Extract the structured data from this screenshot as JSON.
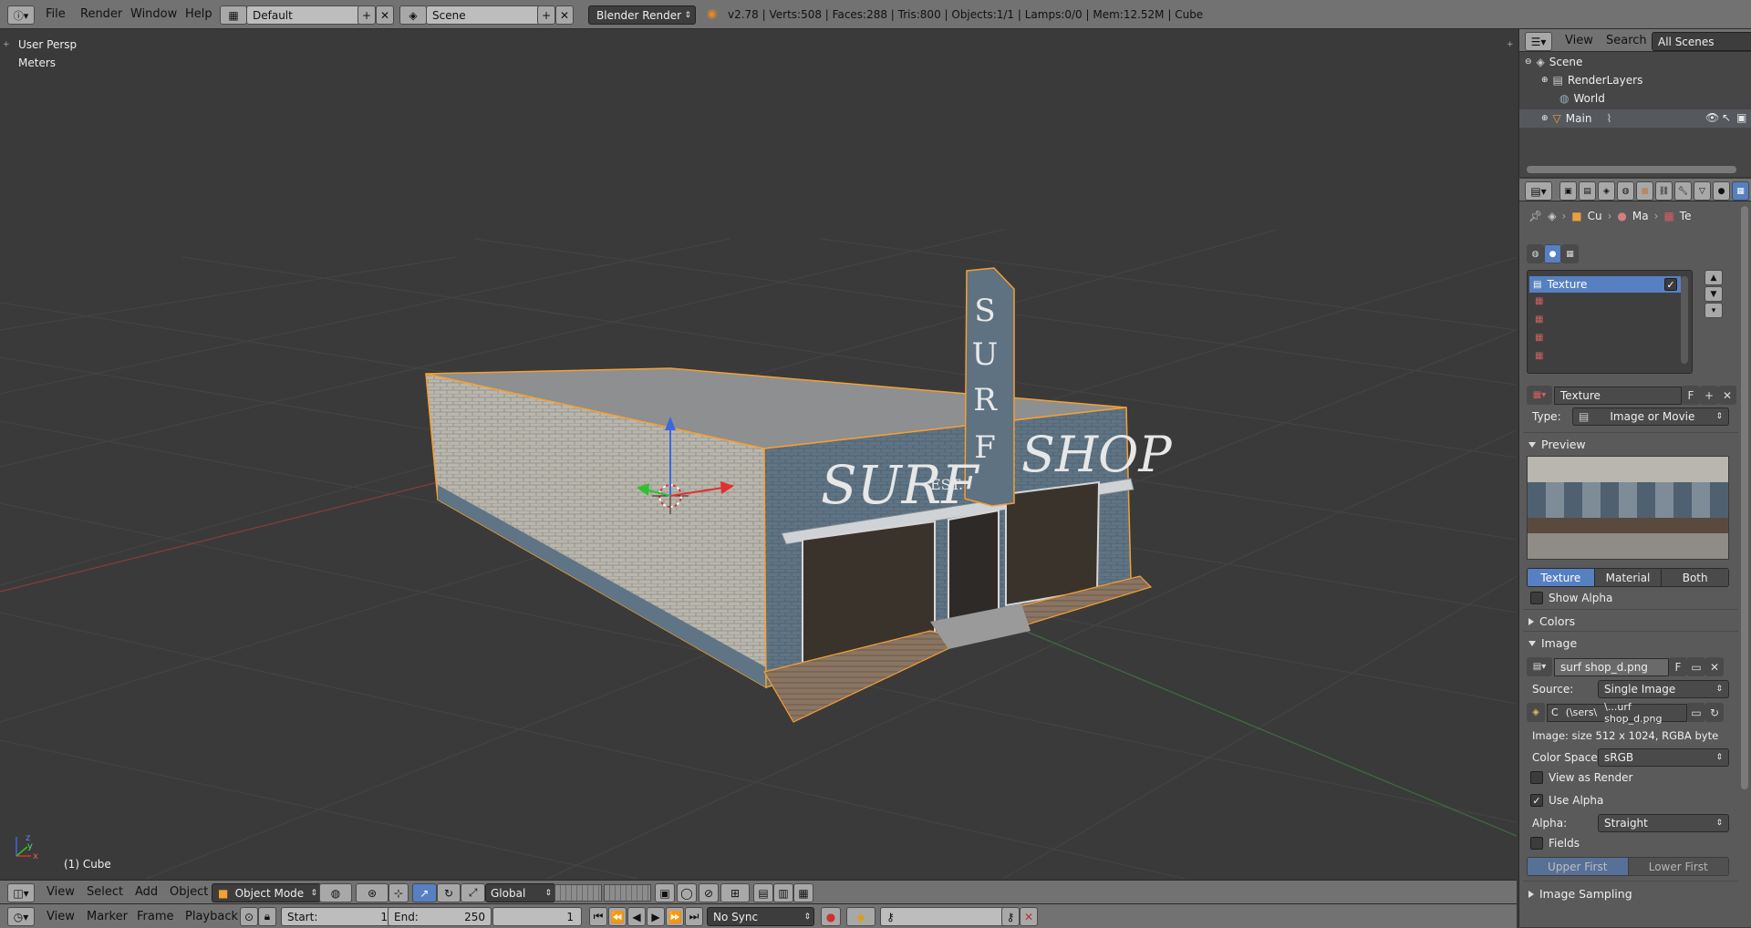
{
  "topbar": {
    "menus": [
      "File",
      "Render",
      "Window",
      "Help"
    ],
    "layout": "Default",
    "scene": "Scene",
    "engine": "Blender Render",
    "stats": "v2.78 | Verts:508 | Faces:288 | Tris:800 | Objects:1/1 | Lamps:0/0 | Mem:12.52M | Cube"
  },
  "viewport": {
    "view_name": "User Persp",
    "units": "Meters",
    "object_label": "(1) Cube",
    "sign_top": "SURF",
    "sign_left": "SURF",
    "sign_right": "SHOP",
    "sign_est": "EST."
  },
  "view3d_header": {
    "menus": [
      "View",
      "Select",
      "Add",
      "Object"
    ],
    "mode": "Object Mode",
    "orientation": "Global"
  },
  "timeline": {
    "menus": [
      "View",
      "Marker",
      "Frame",
      "Playback"
    ],
    "start_label": "Start:",
    "start_value": "1",
    "end_label": "End:",
    "end_value": "250",
    "current_frame": "1",
    "sync": "No Sync"
  },
  "outliner": {
    "menus": [
      "View",
      "Search"
    ],
    "filter": "All Scenes",
    "items": [
      "Scene",
      "RenderLayers",
      "World",
      "Main"
    ]
  },
  "properties": {
    "breadcrumb": [
      "Cu",
      "Ma",
      "Te"
    ],
    "texture_slot": "Texture",
    "texture_name": "Texture",
    "fake_user": "F",
    "type_label": "Type:",
    "type_value": "Image or Movie",
    "preview_header": "Preview",
    "preview_tabs": [
      "Texture",
      "Material",
      "Both"
    ],
    "show_alpha": "Show Alpha",
    "colors_header": "Colors",
    "image_header": "Image",
    "image_name": "surf shop_d.png",
    "source_label": "Source:",
    "source_value": "Single Image",
    "filepath_c": "C",
    "filepath_mid": "(\\sers\\",
    "filepath_end": "\\...urf shop_d.png",
    "image_info": "Image: size 512 x 1024, RGBA byte",
    "colorspace_label": "Color Space:",
    "colorspace_value": "sRGB",
    "view_as_render": "View as Render",
    "use_alpha": "Use Alpha",
    "alpha_label": "Alpha:",
    "alpha_value": "Straight",
    "fields": "Fields",
    "field_order": [
      "Upper First",
      "Lower First"
    ],
    "image_sampling_header": "Image Sampling"
  },
  "colors": {
    "accent": "#5680c2",
    "selection": "#f5a031",
    "header": "#727272"
  }
}
